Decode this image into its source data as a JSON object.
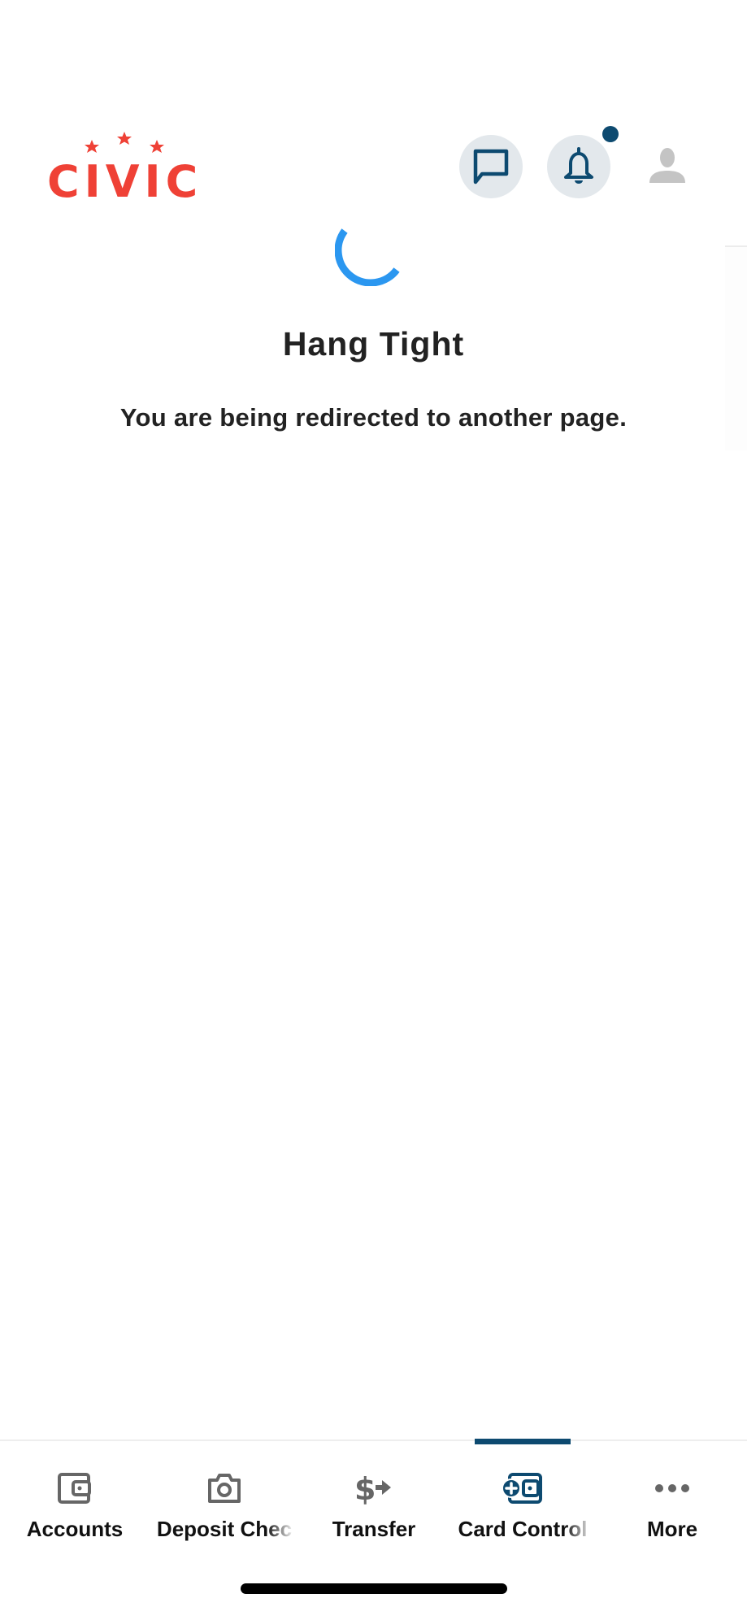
{
  "header": {
    "logo_text": "CIVIC",
    "brand_color": "#ef4136",
    "chat_icon": "chat-bubble-icon",
    "notifications_icon": "bell-icon",
    "notification_dot": true,
    "profile_icon": "user-icon",
    "icon_color": "#0d4a70"
  },
  "main": {
    "loading": true,
    "title": "Hang Tight",
    "message": "You are being redirected to another page."
  },
  "tabbar": {
    "active_index": 3,
    "accent_color": "#0d4a70",
    "tabs": [
      {
        "label": "Accounts",
        "icon": "wallet-icon"
      },
      {
        "label": "Deposit Chec",
        "icon": "camera-icon"
      },
      {
        "label": "Transfer",
        "icon": "dollar-transfer-icon"
      },
      {
        "label": "Card Control",
        "icon": "card-control-icon"
      },
      {
        "label": "More",
        "icon": "more-dots-icon"
      }
    ]
  }
}
